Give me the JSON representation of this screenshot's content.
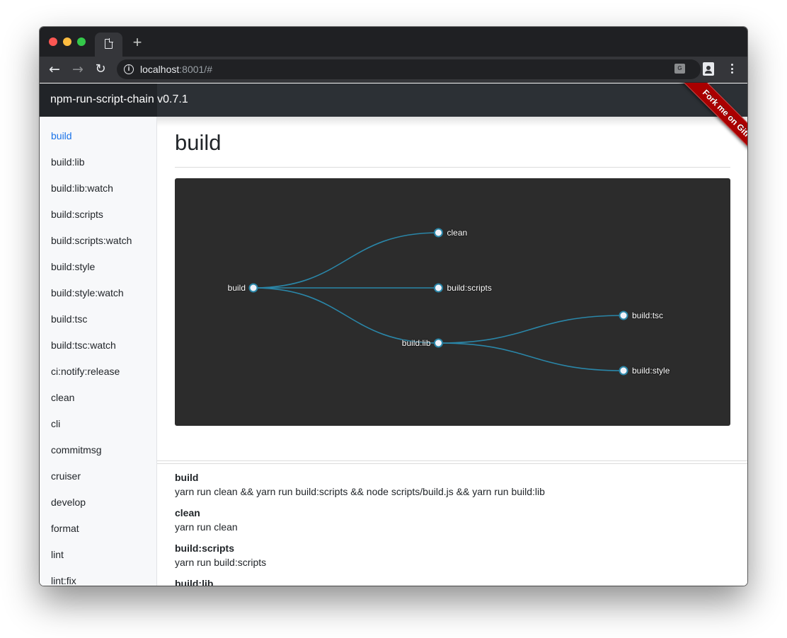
{
  "browser": {
    "tab_icon": "document-icon",
    "new_tab_label": "+",
    "url_host": "localhost",
    "url_rest": ":8001/#",
    "buttons": {
      "back": "←",
      "forward": "→",
      "reload": "↻"
    }
  },
  "app": {
    "brand": "npm-run-script-chain v0.7.1",
    "ribbon": "Fork me on GitHub"
  },
  "sidebar": {
    "active_index": 0,
    "items": [
      {
        "label": "build"
      },
      {
        "label": "build:lib"
      },
      {
        "label": "build:lib:watch"
      },
      {
        "label": "build:scripts"
      },
      {
        "label": "build:scripts:watch"
      },
      {
        "label": "build:style"
      },
      {
        "label": "build:style:watch"
      },
      {
        "label": "build:tsc"
      },
      {
        "label": "build:tsc:watch"
      },
      {
        "label": "ci:notify:release"
      },
      {
        "label": "clean"
      },
      {
        "label": "cli"
      },
      {
        "label": "commitmsg"
      },
      {
        "label": "cruiser"
      },
      {
        "label": "develop"
      },
      {
        "label": "format"
      },
      {
        "label": "lint"
      },
      {
        "label": "lint:fix"
      }
    ]
  },
  "main": {
    "title": "build",
    "graph": {
      "root": "build",
      "nodes": [
        {
          "id": "build",
          "depth": 0,
          "label_side": "left"
        },
        {
          "id": "clean",
          "depth": 1,
          "label_side": "right"
        },
        {
          "id": "build:scripts",
          "depth": 1,
          "label_side": "right"
        },
        {
          "id": "build:lib",
          "depth": 1,
          "label_side": "left"
        },
        {
          "id": "build:tsc",
          "depth": 2,
          "label_side": "right"
        },
        {
          "id": "build:style",
          "depth": 2,
          "label_side": "right"
        }
      ],
      "links": [
        {
          "source": "build",
          "target": "clean"
        },
        {
          "source": "build",
          "target": "build:scripts"
        },
        {
          "source": "build",
          "target": "build:lib"
        },
        {
          "source": "build:lib",
          "target": "build:tsc"
        },
        {
          "source": "build:lib",
          "target": "build:style"
        }
      ]
    },
    "scripts": [
      {
        "name": "build",
        "command": "yarn run clean && yarn run build:scripts && node scripts/build.js && yarn run build:lib"
      },
      {
        "name": "clean",
        "command": "yarn run clean"
      },
      {
        "name": "build:scripts",
        "command": "yarn run build:scripts"
      },
      {
        "name": "build:lib",
        "command": ""
      }
    ]
  }
}
